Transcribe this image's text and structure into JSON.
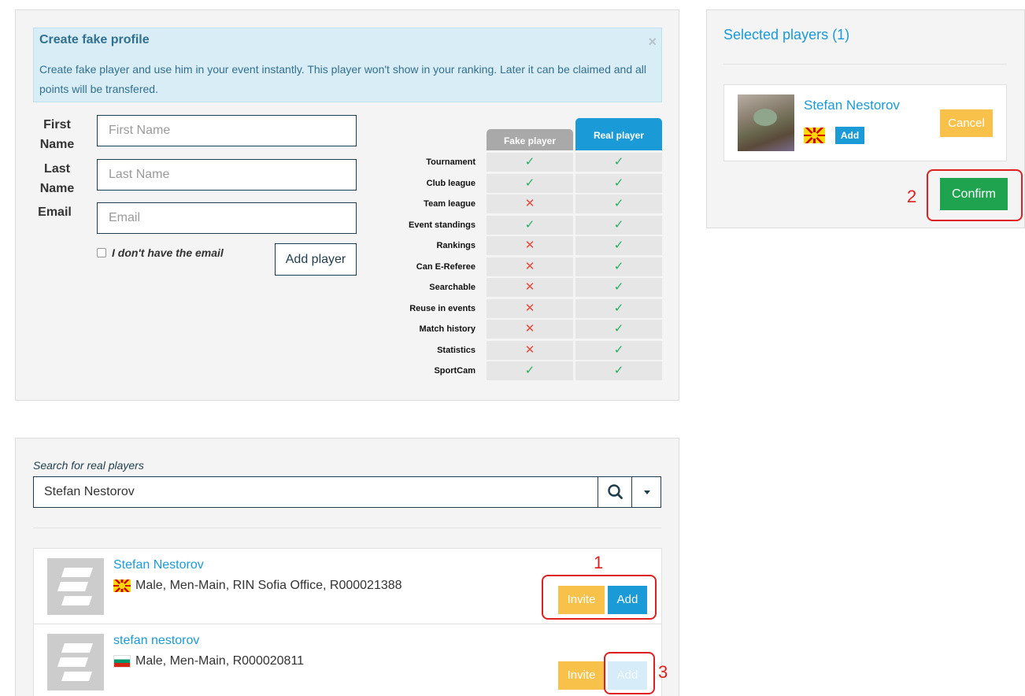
{
  "create_fake": {
    "title": "Create fake profile",
    "description": "Create fake player and use him in your event instantly. This player won't show in your ranking. Later it can be claimed and all points will be transfered.",
    "close_symbol": "×",
    "fields": {
      "first_name": {
        "label": "First Name",
        "placeholder": "First Name",
        "value": ""
      },
      "last_name": {
        "label": "Last Name",
        "placeholder": "Last Name",
        "value": ""
      },
      "email": {
        "label": "Email",
        "placeholder": "Email",
        "value": ""
      }
    },
    "no_email_label": "I don't have the email",
    "no_email_checked": false,
    "add_player_label": "Add player"
  },
  "comparison": {
    "columns": [
      "Fake player",
      "Real player"
    ],
    "rows": [
      {
        "feature": "Tournament",
        "fake": true,
        "real": true
      },
      {
        "feature": "Club league",
        "fake": true,
        "real": true
      },
      {
        "feature": "Team league",
        "fake": false,
        "real": true
      },
      {
        "feature": "Event standings",
        "fake": true,
        "real": true
      },
      {
        "feature": "Rankings",
        "fake": false,
        "real": true
      },
      {
        "feature": "Can E-Referee",
        "fake": false,
        "real": true
      },
      {
        "feature": "Searchable",
        "fake": false,
        "real": true
      },
      {
        "feature": "Reuse in events",
        "fake": false,
        "real": true
      },
      {
        "feature": "Match history",
        "fake": false,
        "real": true
      },
      {
        "feature": "Statistics",
        "fake": false,
        "real": true
      },
      {
        "feature": "SportCam",
        "fake": true,
        "real": true
      }
    ],
    "check_symbol": "✓",
    "cross_symbol": "✕",
    "colors": {
      "check": "#27ae60",
      "cross": "#e74c3c",
      "fake_header": "#a9a9a9",
      "real_header": "#1a9ad6"
    }
  },
  "selected": {
    "title": "Selected players (1)",
    "player": {
      "name": "Stefan Nestorov",
      "flag": "flag-north-macedonia-icon",
      "add_label": "Add",
      "cancel_label": "Cancel"
    },
    "confirm_label": "Confirm"
  },
  "search": {
    "label": "Search for real players",
    "value": "Stefan Nestorov",
    "search_icon": "search-icon",
    "dropdown_icon": "caret-down-icon",
    "results": [
      {
        "name": "Stefan Nestorov",
        "flag": "flag-north-macedonia-icon",
        "info": "Male, Men-Main, RIN Sofia Office, R000021388",
        "invite_label": "Invite",
        "add_label": "Add",
        "add_disabled": false
      },
      {
        "name": "stefan nestorov",
        "flag": "flag-bulgaria-icon",
        "info": "Male, Men-Main, R000020811",
        "invite_label": "Invite",
        "add_label": "Add",
        "add_disabled": true
      }
    ]
  },
  "annotations": [
    "1",
    "2",
    "3"
  ],
  "colors": {
    "accent": "#1a9ad6",
    "confirm": "#1fa34f",
    "warning": "#f8c24a",
    "annotation": "#e02020",
    "navy": "#1f3d4d"
  }
}
